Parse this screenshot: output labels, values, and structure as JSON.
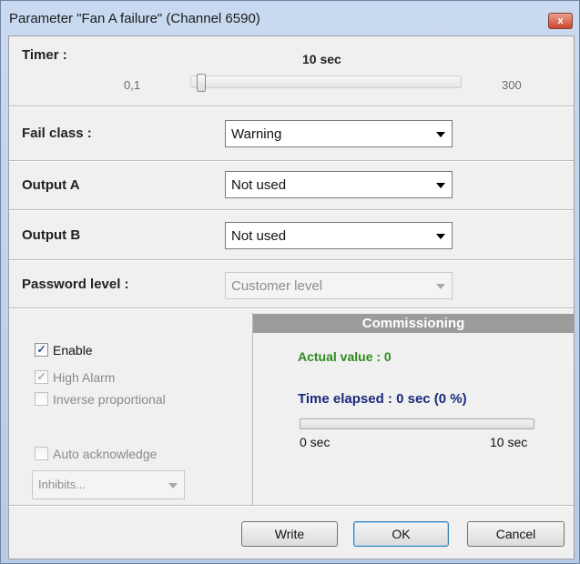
{
  "window": {
    "title": "Parameter \"Fan A failure\" (Channel 6590)",
    "close_glyph": "x"
  },
  "timer": {
    "label": "Timer :",
    "value_text": "10 sec",
    "min_label": "0,1",
    "max_label": "300",
    "value": 10
  },
  "fail_class": {
    "label": "Fail class :",
    "value": "Warning"
  },
  "output_a": {
    "label": "Output A",
    "value": "Not used"
  },
  "output_b": {
    "label": "Output B",
    "value": "Not used"
  },
  "password_level": {
    "label": "Password level :",
    "value": "Customer level",
    "disabled": true
  },
  "options": {
    "enable": {
      "label": "Enable",
      "checked": true,
      "disabled": false
    },
    "high_alarm": {
      "label": "High Alarm",
      "checked": true,
      "disabled": true
    },
    "inverse_proportional": {
      "label": "Inverse proportional",
      "checked": false,
      "disabled": true
    },
    "auto_acknowledge": {
      "label": "Auto acknowledge",
      "checked": false,
      "disabled": true
    },
    "check_glyph": "✓"
  },
  "inhibits": {
    "value": "Inhibits...",
    "disabled": true
  },
  "commissioning": {
    "header": "Commissioning",
    "actual_value": "Actual value : 0",
    "time_elapsed": "Time elapsed : 0 sec (0 %)",
    "progress_percent": 0,
    "progress_min_label": "0 sec",
    "progress_max_label": "10 sec"
  },
  "buttons": {
    "write": "Write",
    "ok": "OK",
    "cancel": "Cancel"
  },
  "colors": {
    "actual_value": "#2f8a1f",
    "time_elapsed": "#1a2a7a",
    "commissioning_header": "#9c9c9c"
  }
}
